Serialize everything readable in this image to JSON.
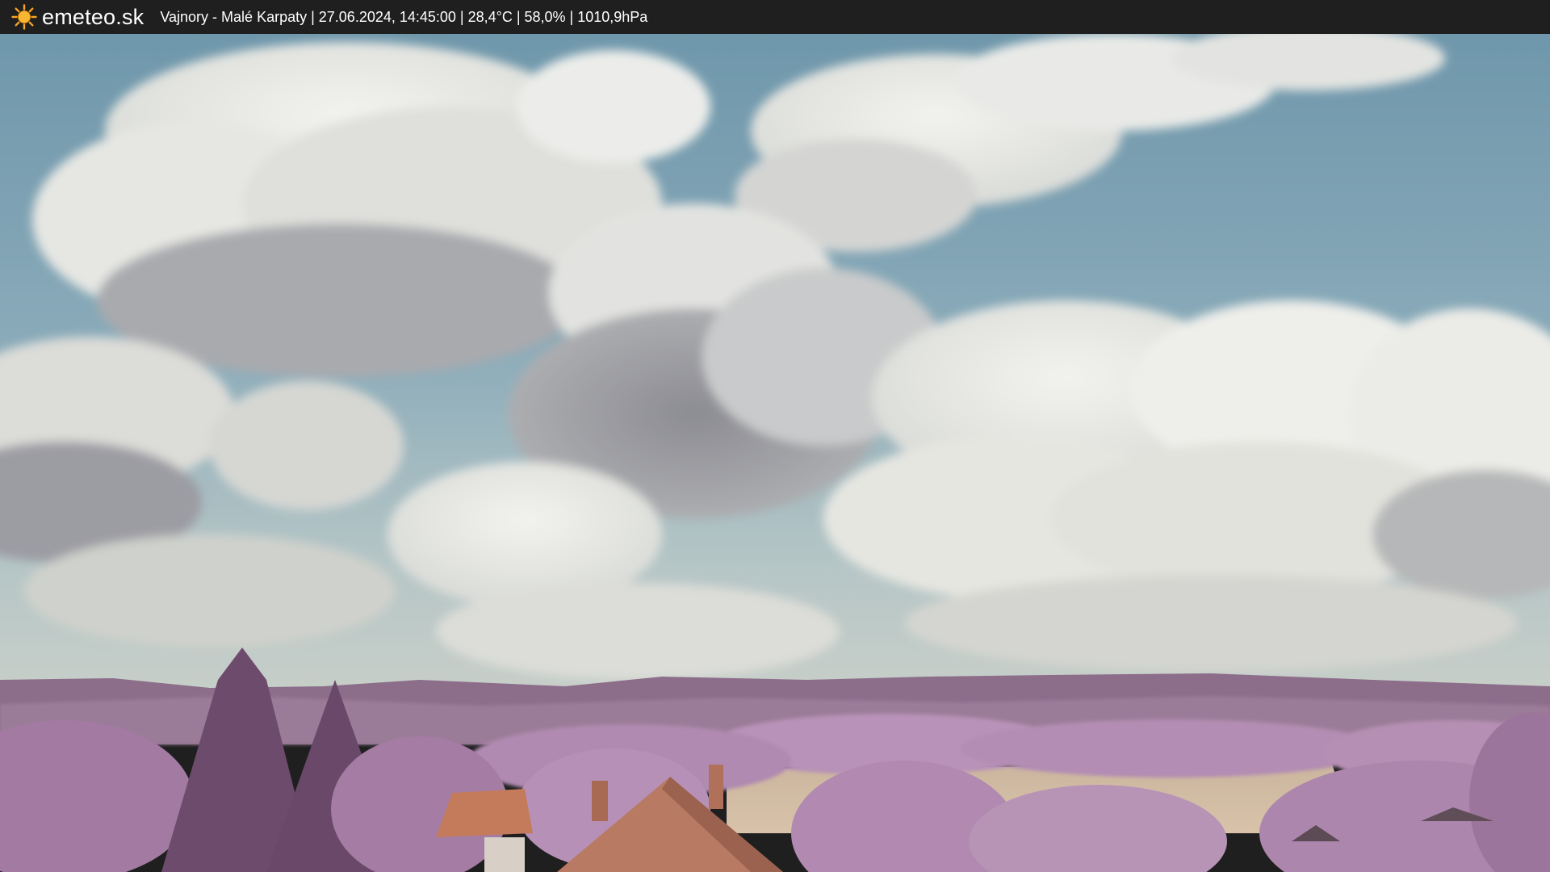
{
  "header": {
    "brand": "emeteo.sk",
    "brand_icon": "sun-icon",
    "caption": "Vajnory - Malé Karpaty | 27.06.2024, 14:45:00 | 28,4°C | 58,0% | 1010,9hPa"
  },
  "colors": {
    "bar": "#1f1f1f",
    "sun": "#f5a623",
    "sky": "#7ea2b3",
    "foliage": "#b28ab3",
    "roof": "#c07a5a"
  }
}
